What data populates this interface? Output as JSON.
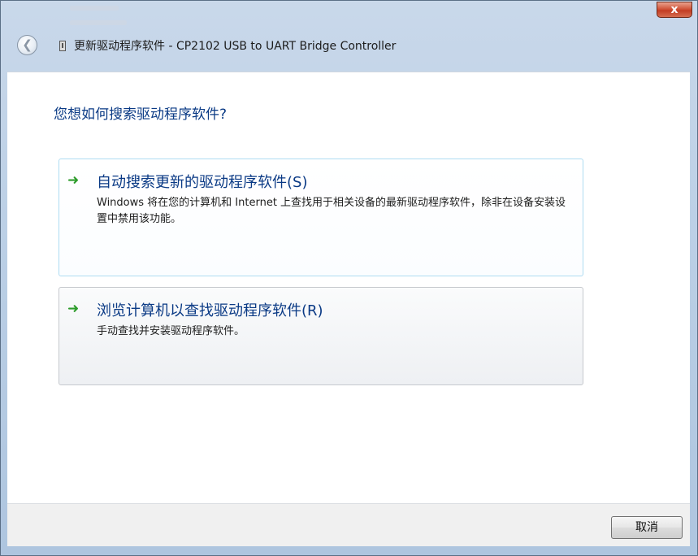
{
  "window": {
    "title": "更新驱动程序软件 - CP2102 USB to UART Bridge Controller",
    "close_label": "x"
  },
  "nav": {
    "back_icon": "back-arrow-icon",
    "back_glyph": "❮",
    "device_icon": "usb-device-icon"
  },
  "main": {
    "question": "您想如何搜索驱动程序软件?",
    "options": [
      {
        "title": "自动搜索更新的驱动程序软件(S)",
        "description": "Windows 将在您的计算机和 Internet 上查找用于相关设备的最新驱动程序软件，除非在设备安装设置中禁用该功能。",
        "icon": "green-arrow-icon",
        "glyph": "➜"
      },
      {
        "title": "浏览计算机以查找驱动程序软件(R)",
        "description": "手动查找并安装驱动程序软件。",
        "icon": "green-arrow-icon",
        "glyph": "➜"
      }
    ]
  },
  "footer": {
    "cancel_label": "取消"
  },
  "colors": {
    "link_blue": "#0a3a85",
    "arrow_green": "#2d9c2b",
    "close_red": "#c33d23"
  }
}
